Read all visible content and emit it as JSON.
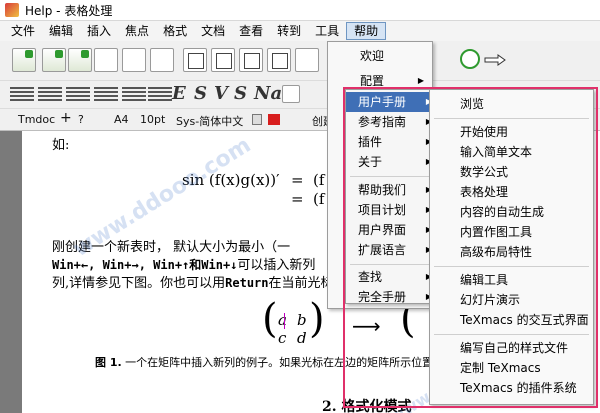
{
  "window": {
    "title": "Help - 表格处理"
  },
  "menubar": {
    "items": [
      "文件",
      "编辑",
      "插入",
      "焦点",
      "格式",
      "文档",
      "查看",
      "转到",
      "工具",
      "帮助"
    ],
    "active": "帮助"
  },
  "toolbar3": {
    "mode": "Tmdoc",
    "paper": "A4",
    "size": "10pt",
    "font": "Sys-简体中文",
    "partial": "创建"
  },
  "format_glyphs": [
    "E",
    "S",
    "V",
    "S",
    "Na"
  ],
  "help_menu": {
    "items": [
      {
        "label": "欢迎",
        "submenu": false
      },
      {
        "label": "配置",
        "submenu": true
      }
    ]
  },
  "help_submenu": {
    "items": [
      {
        "label": "用户手册",
        "submenu": true,
        "highlighted": true
      },
      {
        "label": "参考指南",
        "submenu": true
      },
      {
        "label": "插件",
        "submenu": true
      },
      {
        "label": "关于",
        "submenu": true
      },
      {
        "label": "帮助我们",
        "submenu": true
      },
      {
        "label": "项目计划",
        "submenu": true
      },
      {
        "label": "用户界面",
        "submenu": true
      },
      {
        "label": "扩展语言",
        "submenu": true
      },
      {
        "label": "查找",
        "submenu": true
      },
      {
        "label": "完全手册",
        "submenu": true
      }
    ]
  },
  "manual_submenu": {
    "items": [
      "浏览",
      "开始使用",
      "输入简单文本",
      "数学公式",
      "表格处理",
      "内容的自动生成",
      "内置作图工具",
      "高级布局特性",
      "编辑工具",
      "幻灯片演示",
      "TeXmacs 的交互式界面",
      "编写自己的样式文件",
      "定制 TeXmacs",
      "TeXmacs 的插件系统"
    ]
  },
  "document": {
    "line_ru": "如:",
    "formula_left": "sin (f(x)g(x))′",
    "formula_eq": "=",
    "formula_right_1": "(f",
    "formula_right_2": "(f",
    "para_1": "刚创建一个新表时，   默认大小为最小（一",
    "para_2_keys": "Win+←,  Win+→,  Win+↑和Win+↓",
    "para_2_text": "可以插入新列",
    "para_3_a": "列,详情参见下图。你也可以用",
    "para_3_key": "Return",
    "para_3_b": "在当前光标",
    "matrix_a": "a",
    "matrix_b": "b",
    "matrix_c": "c",
    "matrix_d": "d",
    "matrix_arrow": "⟶",
    "caption_label": "图 1.",
    "caption_text": "一个在矩阵中插入新列的例子。如果光标在左边的矩阵所示位置",
    "section_title": "2.  格式化模式"
  },
  "watermark_text": "www.ddooo.com",
  "colors": {
    "highlight": "#3f6fb6",
    "annotation_box": "#e0306a",
    "active_menu": "#d6e4f4"
  }
}
